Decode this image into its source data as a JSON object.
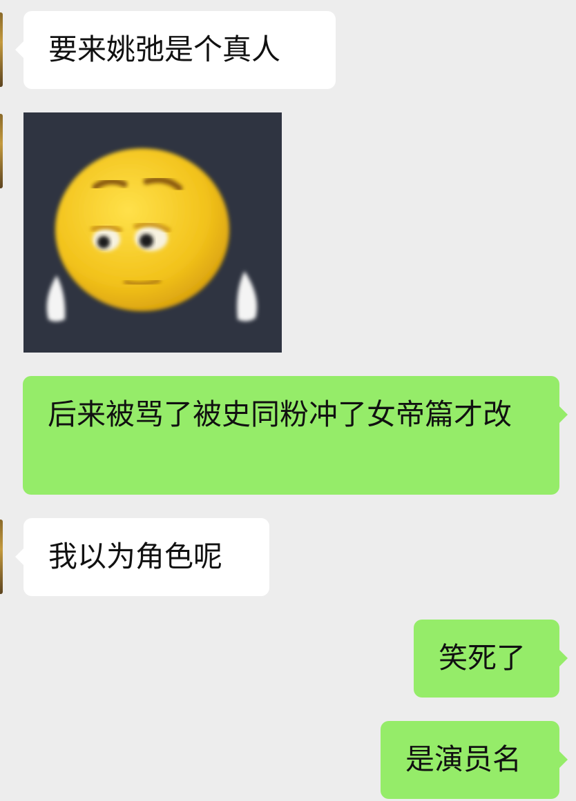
{
  "chat": {
    "messages": [
      {
        "side": "in",
        "type": "text",
        "text": "要来姚弛是个真人"
      },
      {
        "side": "in",
        "type": "sticker",
        "sticker": "sad-emoji-sticker"
      },
      {
        "side": "out",
        "type": "text",
        "text": "后来被骂了被史同粉冲了女帝篇才改"
      },
      {
        "side": "in",
        "type": "text",
        "text": "我以为角色呢"
      },
      {
        "side": "out",
        "type": "text",
        "text": "笑死了"
      },
      {
        "side": "out",
        "type": "text",
        "text": "是演员名"
      }
    ]
  },
  "colors": {
    "background": "#ededed",
    "incoming_bubble": "#ffffff",
    "outgoing_bubble": "#95ec69",
    "sticker_background": "#2f3441",
    "emoji_face": "#f2c21b"
  }
}
